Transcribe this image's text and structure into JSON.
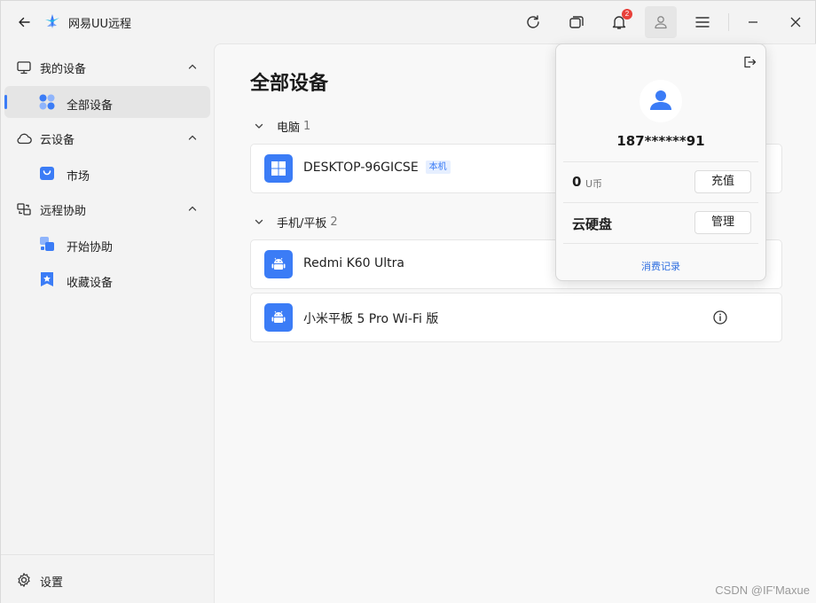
{
  "app": {
    "title": "网易UU远程"
  },
  "titlebar": {
    "notification_count": "2",
    "icons": [
      "back-icon",
      "refresh-icon",
      "windows-icon",
      "bell-icon",
      "user-icon",
      "menu-icon",
      "minimize-icon",
      "close-icon"
    ]
  },
  "sidebar": {
    "groups": [
      {
        "label": "我的设备",
        "items": [
          {
            "label": "全部设备",
            "active": true
          }
        ]
      },
      {
        "label": "云设备",
        "items": [
          {
            "label": "市场"
          }
        ]
      },
      {
        "label": "远程协助",
        "items": [
          {
            "label": "开始协助"
          },
          {
            "label": "收藏设备"
          }
        ]
      }
    ],
    "settings_label": "设置"
  },
  "main": {
    "title": "全部设备",
    "sections": [
      {
        "label": "电脑",
        "count": "1",
        "devices": [
          {
            "name": "DESKTOP-96GICSE",
            "badge": "本机",
            "type": "windows"
          }
        ]
      },
      {
        "label": "手机/平板",
        "count": "2",
        "devices": [
          {
            "name": "Redmi K60 Ultra",
            "type": "android"
          },
          {
            "name": "小米平板 5 Pro Wi-Fi 版",
            "type": "android"
          }
        ]
      }
    ]
  },
  "popup": {
    "username": "187******91",
    "coin_value": "0",
    "coin_unit": "U币",
    "recharge_label": "充值",
    "cloud_disk_label": "云硬盘",
    "manage_label": "管理",
    "records_label": "消费记录"
  },
  "watermark": "CSDN @IF'Maxue",
  "colors": {
    "accent": "#3b7cf6",
    "badge_red": "#e8403a"
  }
}
